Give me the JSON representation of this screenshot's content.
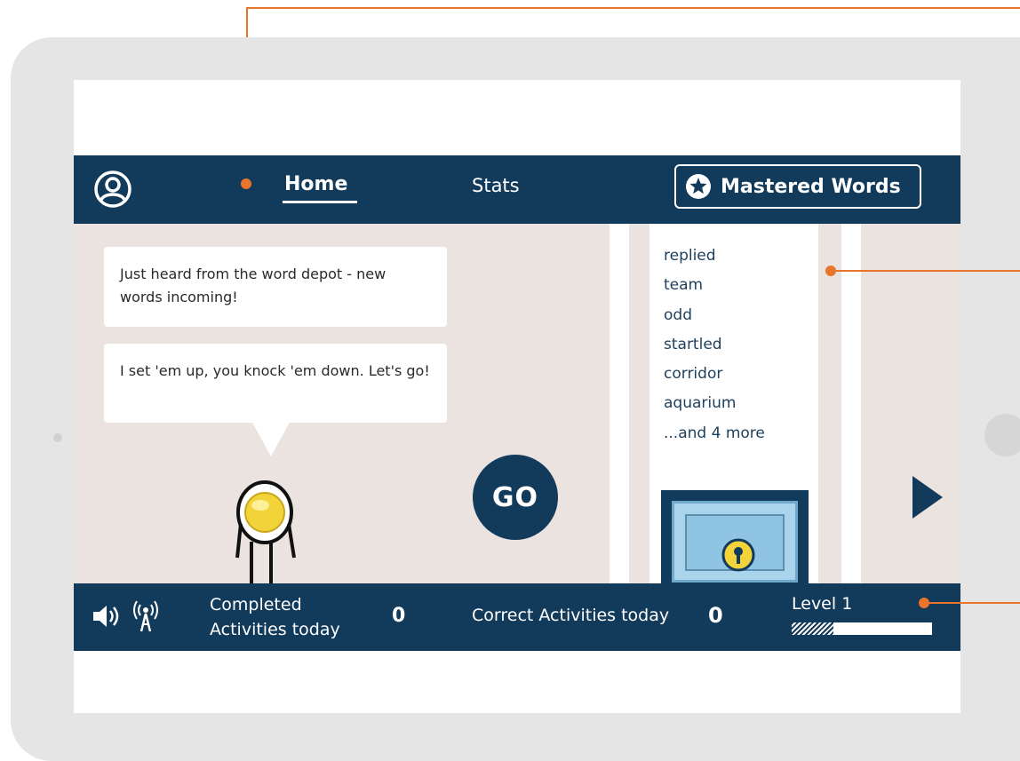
{
  "nav": {
    "home_label": "Home",
    "stats_label": "Stats",
    "mastered_label": "Mastered Words"
  },
  "messages": {
    "bubble1": "Just heard from the word depot - new words incoming!",
    "bubble2": "I set 'em up, you knock 'em down. Let's go!"
  },
  "go_label": "GO",
  "words": {
    "items": [
      "replied",
      "team",
      "odd",
      "startled",
      "corridor",
      "aquarium",
      "...and 4 more"
    ]
  },
  "footer": {
    "completed_label": "Completed Activities today",
    "completed_value": "0",
    "correct_label": "Correct Activities today",
    "correct_value": "0",
    "level_label": "Level 1",
    "level_progress_fraction": 0.3
  },
  "colors": {
    "navy": "#123a5a",
    "accent_orange": "#e8752a",
    "main_bg": "#ebe3e0"
  },
  "icons": [
    "profile-icon",
    "star-icon",
    "speaker-icon",
    "antenna-icon",
    "keyhole-icon",
    "next-arrow-icon"
  ]
}
